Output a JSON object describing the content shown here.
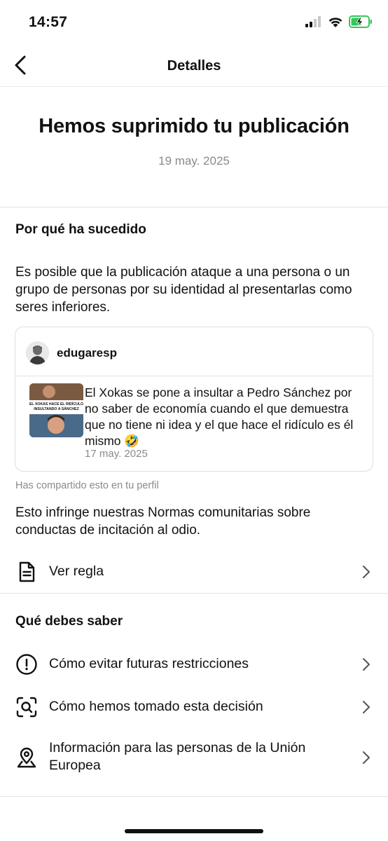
{
  "status_bar": {
    "time": "14:57"
  },
  "nav": {
    "title": "Detalles"
  },
  "hero": {
    "title": "Hemos suprimido tu publicación",
    "date": "19 may. 2025"
  },
  "why": {
    "heading": "Por qué ha sucedido",
    "body": "Es posible que la publicación ataque a una persona o un grupo de personas por su identidad al presentarlas como seres inferiores."
  },
  "post": {
    "username": "edugaresp",
    "thumb_caption": "EL XOKAS HACE EL RIDÍCULO INSULTANDO A SÁNCHEZ",
    "text": "El Xokas se pone a insultar a Pedro Sánchez por no saber de economía cuando el que demuestra que no tiene ni idea y el que hace el ridículo es él mismo 🤣",
    "date": "17 may. 2025"
  },
  "shared_note": "Has compartido esto en tu perfil",
  "violation": "Esto infringe nuestras Normas comunitarias sobre conductas de incitación al odio.",
  "rule_row": {
    "label": "Ver regla",
    "icon": "document-icon"
  },
  "know": {
    "heading": "Qué debes saber",
    "items": [
      {
        "label": "Cómo evitar futuras restricciones",
        "icon": "exclamation-circle-icon"
      },
      {
        "label": "Cómo hemos tomado esta decisión",
        "icon": "scan-search-icon"
      },
      {
        "label": "Información para las personas de la Unión Europea",
        "icon": "map-pin-icon"
      }
    ]
  },
  "colors": {
    "text": "#111111",
    "secondary": "#8a8a8a",
    "divider": "#e4e4e4",
    "battery_green": "#34c759"
  }
}
